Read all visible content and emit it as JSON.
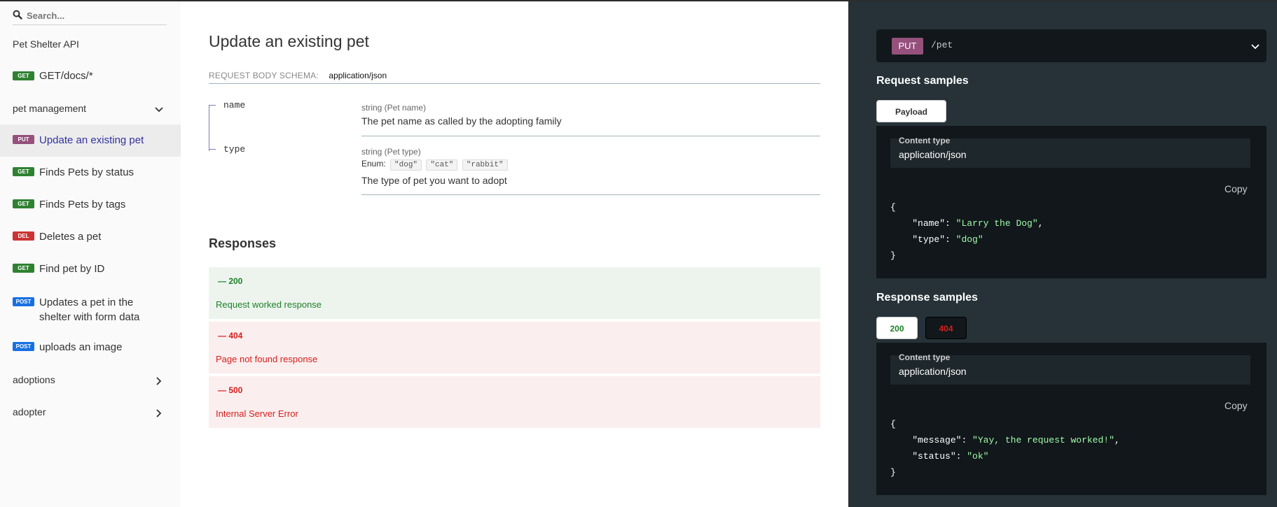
{
  "sidebar": {
    "search_placeholder": "Search...",
    "api_title": "Pet Shelter API",
    "items": [
      {
        "badge": "GET",
        "label": "GET/docs/*"
      },
      {
        "badge": "PUT",
        "label": "Update an existing pet",
        "active": true
      },
      {
        "badge": "GET",
        "label": "Finds Pets by status"
      },
      {
        "badge": "GET",
        "label": "Finds Pets by tags"
      },
      {
        "badge": "DEL",
        "label": "Deletes a pet"
      },
      {
        "badge": "GET",
        "label": "Find pet by ID"
      },
      {
        "badge": "POST",
        "label": "Updates a pet in the",
        "label2": "shelter with form data"
      },
      {
        "badge": "POST",
        "label": "uploads an image"
      }
    ],
    "groups": [
      {
        "label": "pet management",
        "state": "expanded"
      },
      {
        "label": "adoptions",
        "state": "collapsed"
      },
      {
        "label": "adopter",
        "state": "collapsed"
      }
    ]
  },
  "main": {
    "title": "Update an existing pet",
    "schema_label": "REQUEST BODY SCHEMA:",
    "schema_type": "application/json",
    "properties": [
      {
        "name": "name",
        "type": "string (Pet name)",
        "description": "The pet name as called by the adopting family"
      },
      {
        "name": "type",
        "type": "string (Pet type)",
        "enum_label": "Enum:",
        "enum": [
          "\"dog\"",
          "\"cat\"",
          "\"rabbit\""
        ],
        "description": "The type of pet you want to adopt"
      }
    ],
    "responses_title": "Responses",
    "responses": [
      {
        "code": "— 200",
        "description": "Request worked response"
      },
      {
        "code": "— 404",
        "description": "Page not found response"
      },
      {
        "code": "— 500",
        "description": "Internal Server Error"
      }
    ]
  },
  "right": {
    "method": "PUT",
    "path": "/pet",
    "request_title": "Request samples",
    "request_tab": "Payload",
    "content_type_label": "Content type",
    "content_type": "application/json",
    "copy_label": "Copy",
    "request_json": {
      "open": "{",
      "k1": "\"name\"",
      "v1": "\"Larry the Dog\"",
      "k2": "\"type\"",
      "v2": "\"dog\"",
      "close": "}"
    },
    "response_title": "Response samples",
    "response_tabs": [
      "200",
      "404"
    ],
    "response_json": {
      "open": "{",
      "k1": "\"message\"",
      "v1": "\"Yay, the request worked!\"",
      "k2": "\"status\"",
      "v2": "\"ok\"",
      "close": "}"
    }
  },
  "colors": {
    "get": "#2f8132",
    "put": "#95507c",
    "delete": "#cc3333",
    "post": "#186fe3",
    "right_panel": "#263238",
    "success": "#1d8127",
    "error": "#d41f1c",
    "json_string": "#a0fbaa"
  },
  "icons": [
    "search-icon",
    "chevron-down-icon",
    "chevron-right-icon"
  ]
}
